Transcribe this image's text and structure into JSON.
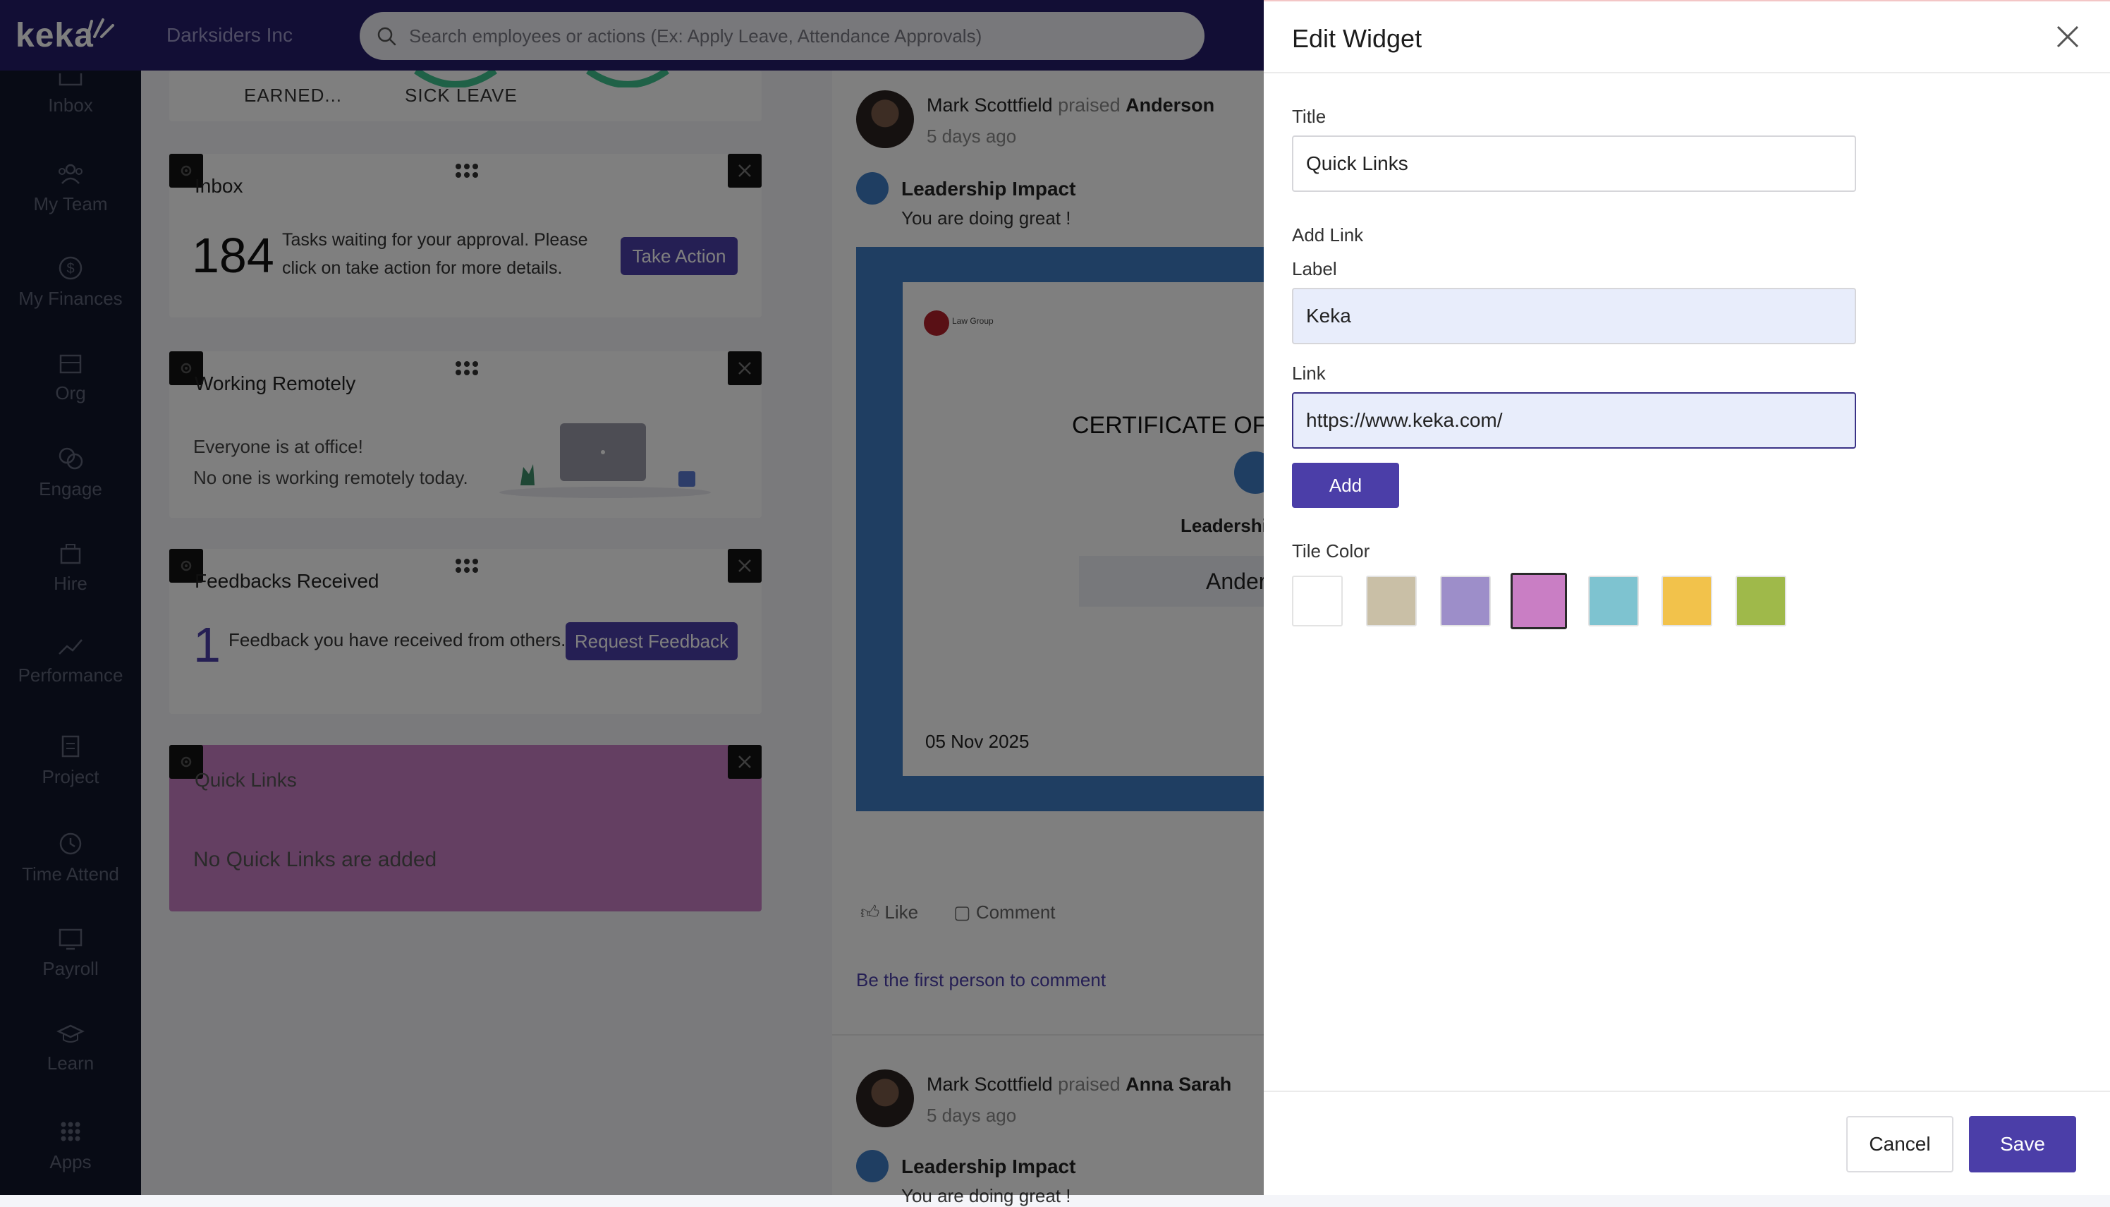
{
  "topbar": {
    "logo": "keka",
    "company": "Darksiders Inc",
    "search_placeholder": "Search employees or actions (Ex: Apply Leave, Attendance Approvals)"
  },
  "sidebar": {
    "items": [
      {
        "label": "Inbox",
        "icon": "inbox-icon"
      },
      {
        "label": "My Team",
        "icon": "team-icon"
      },
      {
        "label": "My Finances",
        "icon": "finances-icon"
      },
      {
        "label": "Org",
        "icon": "org-icon"
      },
      {
        "label": "Engage",
        "icon": "engage-icon"
      },
      {
        "label": "Hire",
        "icon": "hire-icon"
      },
      {
        "label": "Performance",
        "icon": "performance-icon"
      },
      {
        "label": "Project",
        "icon": "project-icon"
      },
      {
        "label": "Time Attend",
        "icon": "clock-icon"
      },
      {
        "label": "Payroll",
        "icon": "payroll-icon"
      },
      {
        "label": "Learn",
        "icon": "learn-icon"
      },
      {
        "label": "Apps",
        "icon": "apps-icon"
      }
    ]
  },
  "leave": {
    "earned": "EARNED...",
    "sick": "SICK LEAVE"
  },
  "widgets": {
    "inbox": {
      "title": "Inbox",
      "count": "184",
      "text": "Tasks waiting for your approval. Please click on take action for more details.",
      "button": "Take Action"
    },
    "remote": {
      "title": "Working Remotely",
      "line1": "Everyone is at office!",
      "line2": "No one is working remotely today."
    },
    "feedback": {
      "title": "Feedbacks Received",
      "count": "1",
      "text": "Feedback you have received from others.",
      "button": "Request Feedback"
    },
    "quicklinks": {
      "title": "Quick Links",
      "empty": "No Quick Links are added",
      "color": "#c97ec4"
    }
  },
  "feed": {
    "post1": {
      "author": "Mark Scottfield",
      "verb": "praised",
      "target": "Anderson",
      "time": "5 days ago",
      "badge": "Leadership Impact",
      "message": "You are doing great !",
      "cert_logo": "Law Group",
      "cert_title": "CERTIFICATE OF",
      "cert_badge": "Leadership",
      "cert_name": "Ander",
      "cert_date": "05 Nov 2025",
      "like": "Like",
      "comment": "Comment",
      "first_comment": "Be the first person to comment"
    },
    "post2": {
      "author": "Mark Scottfield",
      "verb": "praised",
      "target": "Anna Sarah",
      "time": "5 days ago",
      "badge": "Leadership Impact",
      "message": "You are doing great !"
    }
  },
  "panel": {
    "title": "Edit Widget",
    "title_label": "Title",
    "title_value": "Quick Links",
    "add_link": "Add Link",
    "label_label": "Label",
    "label_value": "Keka",
    "link_label": "Link",
    "link_value": "https://www.keka.com/",
    "add_button": "Add",
    "tile_color": "Tile Color",
    "swatches": [
      "#ffffff",
      "#c9bfa6",
      "#9d8ec9",
      "#c97ec4",
      "#7ec3d0",
      "#f2c24b",
      "#9fb94a"
    ],
    "selected_swatch": 3,
    "cancel": "Cancel",
    "save": "Save"
  }
}
